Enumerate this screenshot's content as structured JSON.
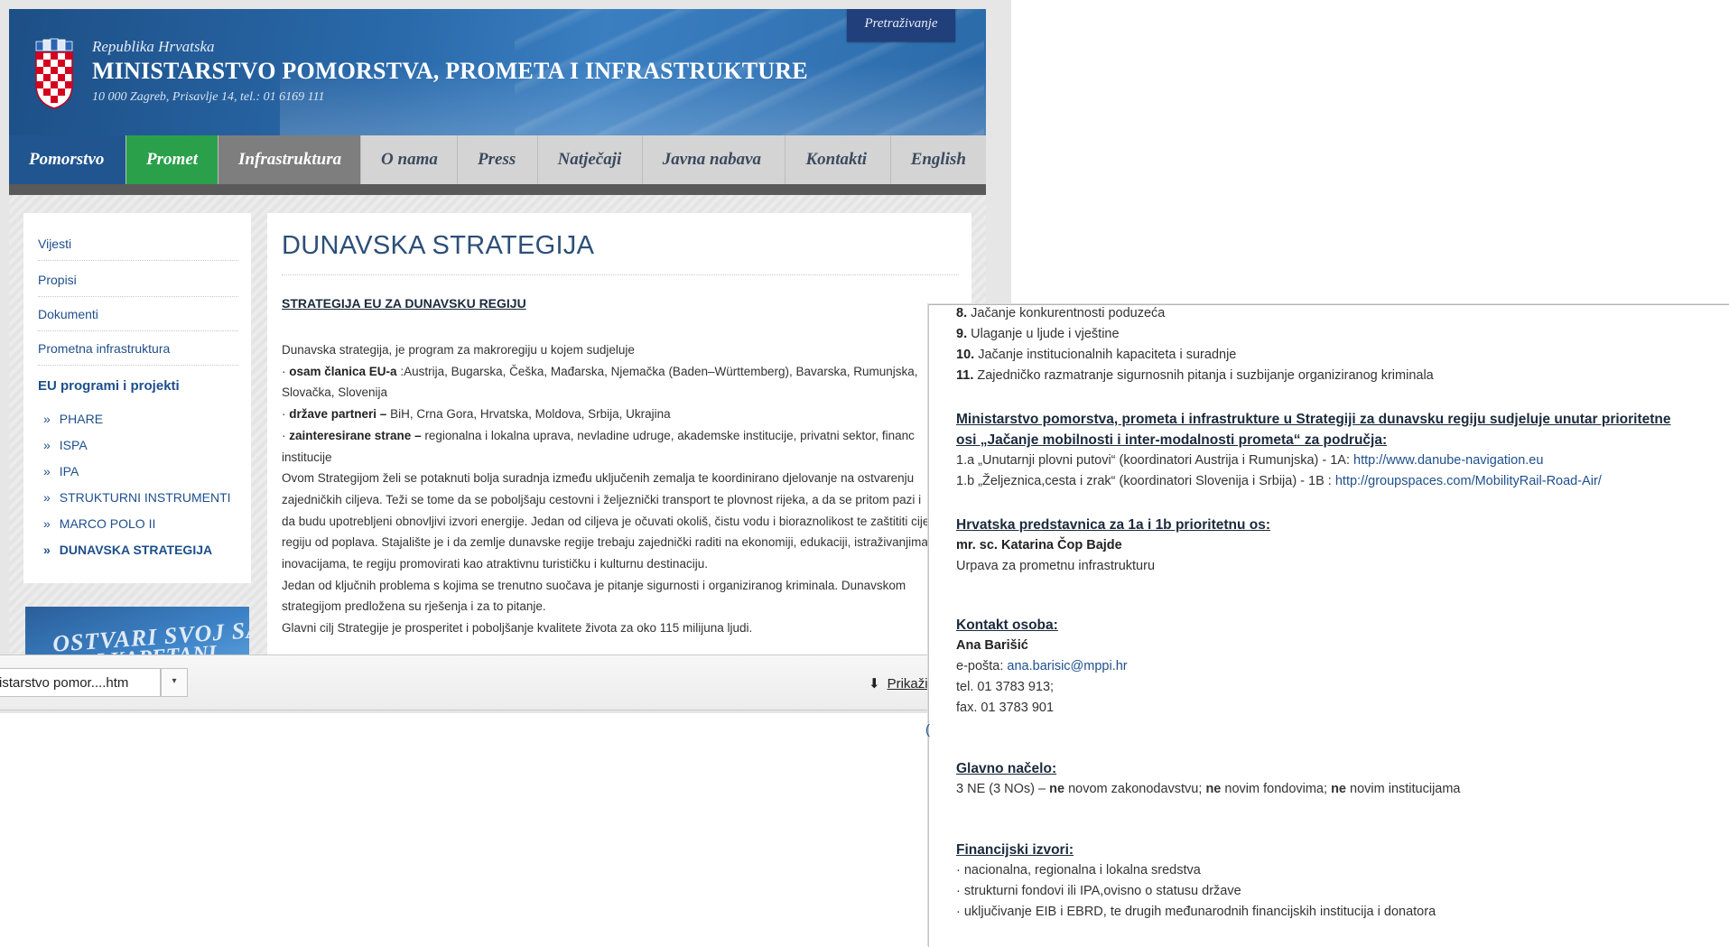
{
  "header": {
    "republika": "Republika Hrvatska",
    "ministry": "MINISTARSTVO POMORSTVA, PROMETA I INFRASTRUKTURE",
    "address": "10 000 Zagreb, Prisavlje 14, tel.: 01 6169 111",
    "search_label": "Pretraživanje"
  },
  "nav": [
    "Pomorstvo",
    "Promet",
    "Infrastruktura",
    "O nama",
    "Press",
    "Natječaji",
    "Javna nabava",
    "Kontakti",
    "English"
  ],
  "sidebar": {
    "links": [
      "Vijesti",
      "Propisi",
      "Dokumenti",
      "Prometna infrastruktura"
    ],
    "section": "EU programi i projekti",
    "sub": [
      "PHARE",
      "ISPA",
      "IPA",
      "STRUKTURNI INSTRUMENTI",
      "MARCO POLO II",
      "DUNAVSKA STRATEGIJA"
    ],
    "banner_line1": "OSTVARI SVOJ SAN",
    "banner_line2": "...I KAPETANI"
  },
  "content": {
    "title": "DUNAVSKA STRATEGIJA",
    "subtitle": "STRATEGIJA EU ZA DUNAVSKU REGIJU",
    "l1": "Dunavska strategija, je program za makroregiju u kojem sudjeluje",
    "l2a": "osam članica EU-a",
    "l2b": ":Austrija, Bugarska, Češka, Mađarska, Njemačka (Baden–Württemberg), Bavarska, Rumunjska,",
    "l3": "Slovačka, Slovenija",
    "l4a": "države partneri –",
    "l4b": "BiH, Crna Gora, Hrvatska, Moldova, Srbija, Ukrajina",
    "l5a": "zainteresirane strane –",
    "l5b": "regionalna i lokalna uprava, nevladine udruge, akademske institucije, privatni sektor, financ",
    "l6": "institucije",
    "l7": "Ovom Strategijom želi se potaknuti bolja suradnja između uključenih zemalja te koordinirano djelovanje na ostvarenju",
    "l8": "zajedničkih ciljeva. Teži se tome da se poboljšaju cestovni i željeznički transport te plovnost rijeka, a da se pritom pazi i",
    "l9": "da budu upotrebljeni obnovljivi izvori energije. Jedan od ciljeva je očuvati okoliš, čistu vodu i bioraznolikost te zaštititi cije",
    "l10": "regiju od poplava. Stajalište je i da  zemlje dunavske regije  trebaju zajednički raditi na ekonomiji, edukaciji, istraživanjima",
    "l11": "inovacijama, te regiju  promovirati kao atraktivnu turističku i kulturnu destinaciju.",
    "l12": "Jedan od ključnih problema s kojima se trenutno suočava je pitanje sigurnosti i organiziranog kriminala. Dunavskom",
    "l13": "strategijom predložena su rješenja i za to pitanje.",
    "l14": "Glavni cilj Strategije je prosperitet i poboljšanje kvalitete života za oko 115 milijuna ljudi."
  },
  "download_bar": {
    "file": "istarstvo pomor....htm",
    "show": "Prikaži"
  },
  "right": {
    "p8n": "8.",
    "p8": "Jačanje konkurentnosti poduzeća",
    "p9n": "9.",
    "p9": "Ulaganje u ljude i vještine",
    "p10n": "10.",
    "p10": "Jačanje institucionalnih kapaciteta i suradnje",
    "p11n": "11.",
    "p11": "Zajedničko razmatranje sigurnosnih pitanja i suzbijanje organiziranog kriminala",
    "head1a": "Ministarstvo pomorstva, prometa i infrastrukture u Strategiji za dunavsku regiju sudjeluje unutar prioritetne",
    "head1b": "osi „Jačanje mobilnosti i inter-modalnosti prometa“ za područja:",
    "a1": "1.a „Unutarnji plovni putovi“ (koordinatori Austrija i Rumunjska) - 1A: ",
    "a1link": "http://www.danube-navigation.eu",
    "b1": "1.b „Željeznica,cesta i zrak“ (koordinatori Slovenija i Srbija) - 1B : ",
    "b1link": "http://groupspaces.com/MobilityRail-Road-Air/",
    "head2": "Hrvatska predstavnica za 1a i 1b prioritetnu os:",
    "rep_name": "mr. sc. Katarina Čop Bajde",
    "rep_org": "Urpava za prometnu infrastrukturu",
    "head3": "Kontakt osoba:",
    "contact_name": "Ana Barišić",
    "email_label": "e-pošta: ",
    "email": "ana.barisic@mppi.hr",
    "tel": "tel. 01 3783 913;",
    "fax": "fax. 01 3783 901",
    "head4": "Glavno načelo:",
    "principle_a": "3 NE (3 NOs) – ",
    "ne": "ne",
    "principle_b": " novom zakonodavstvu; ",
    "principle_c": " novim fondovima; ",
    "principle_d": " novim institucijama",
    "head5": "Financijski izvori:",
    "f1": "· nacionalna, regionalna i lokalna sredstva",
    "f2": "· strukturni fondovi ili IPA,ovisno o statusu države",
    "f3": "· uključivanje EIB i EBRD, te drugih međunarodnih financijskih institucija i donatora"
  }
}
